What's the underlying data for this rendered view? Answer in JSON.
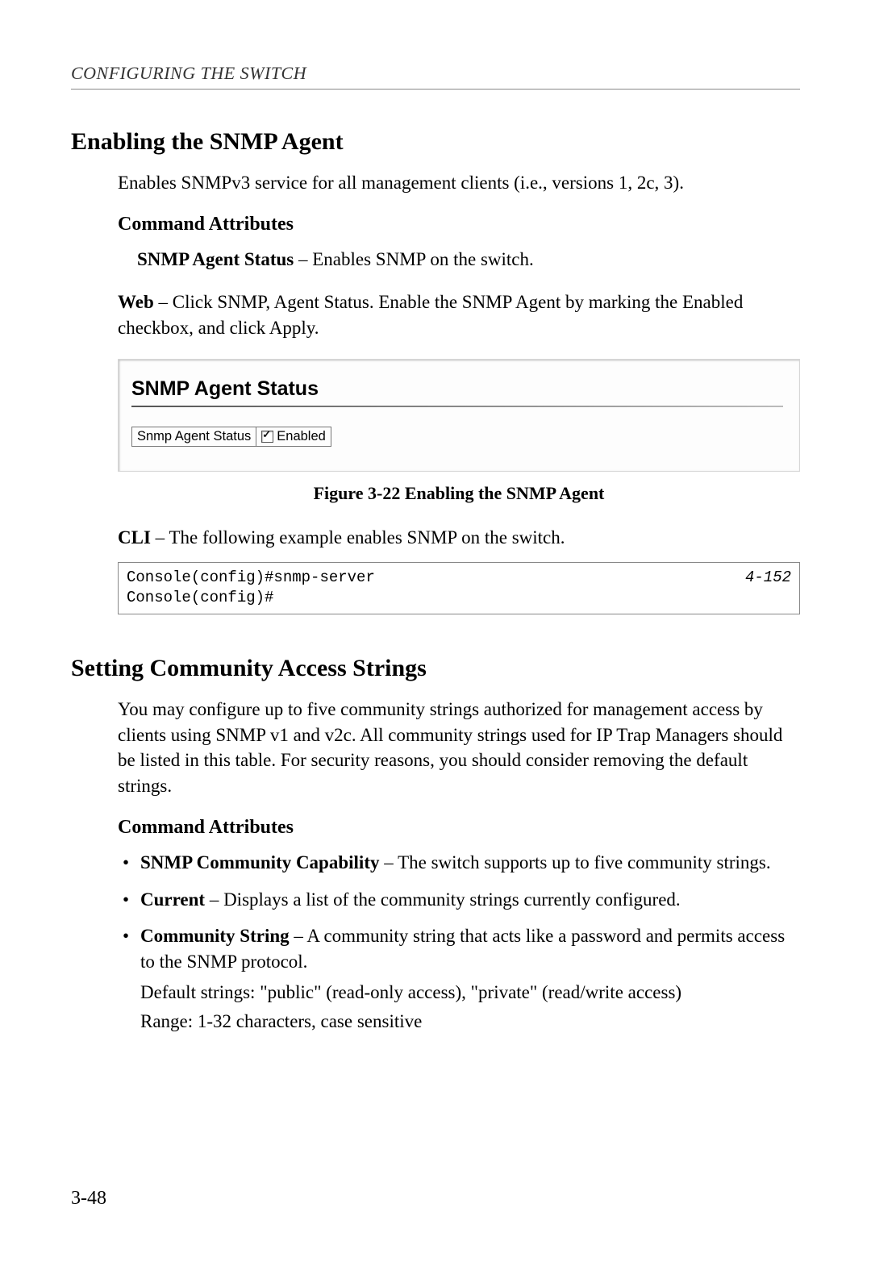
{
  "header": {
    "text": "CONFIGURING THE SWITCH"
  },
  "section1": {
    "title": "Enabling the SNMP Agent",
    "intro": "Enables SNMPv3 service for all management clients (i.e., versions 1, 2c, 3).",
    "cmd_attr_heading": "Command Attributes",
    "attr": {
      "label": "SNMP Agent Status",
      "desc": " – Enables SNMP on the switch."
    },
    "web": {
      "lead": "Web",
      "rest": " – Click SNMP, Agent Status. Enable the SNMP Agent by marking the Enabled checkbox, and click Apply."
    },
    "figure": {
      "panel_title": "SNMP Agent Status",
      "row_label": "Snmp Agent Status",
      "checkbox_label": "Enabled",
      "caption": "Figure 3-22  Enabling the SNMP Agent"
    },
    "cli": {
      "lead": "CLI",
      "rest": " – The following example enables SNMP on the switch.",
      "console": "Console(config)#snmp-server\nConsole(config)#",
      "ref": "4-152"
    }
  },
  "section2": {
    "title": "Setting Community Access Strings",
    "intro": "You may configure up to five community strings authorized for management access by clients using SNMP v1 and v2c. All community strings used for IP Trap Managers should be listed in this table. For security reasons, you should consider removing the default strings.",
    "cmd_attr_heading": "Command Attributes",
    "bullets": [
      {
        "label": "SNMP Community Capability",
        "desc": " – The switch supports up to five community strings."
      },
      {
        "label": "Current",
        "desc": " – Displays a list of the community strings currently configured."
      },
      {
        "label": "Community String",
        "desc": " – A community string that acts like a password and permits access to the SNMP protocol.",
        "extra1": "Default strings: \"public\" (read-only access), \"private\" (read/write access)",
        "extra2": "Range: 1-32 characters, case sensitive"
      }
    ]
  },
  "page_number": "3-48"
}
